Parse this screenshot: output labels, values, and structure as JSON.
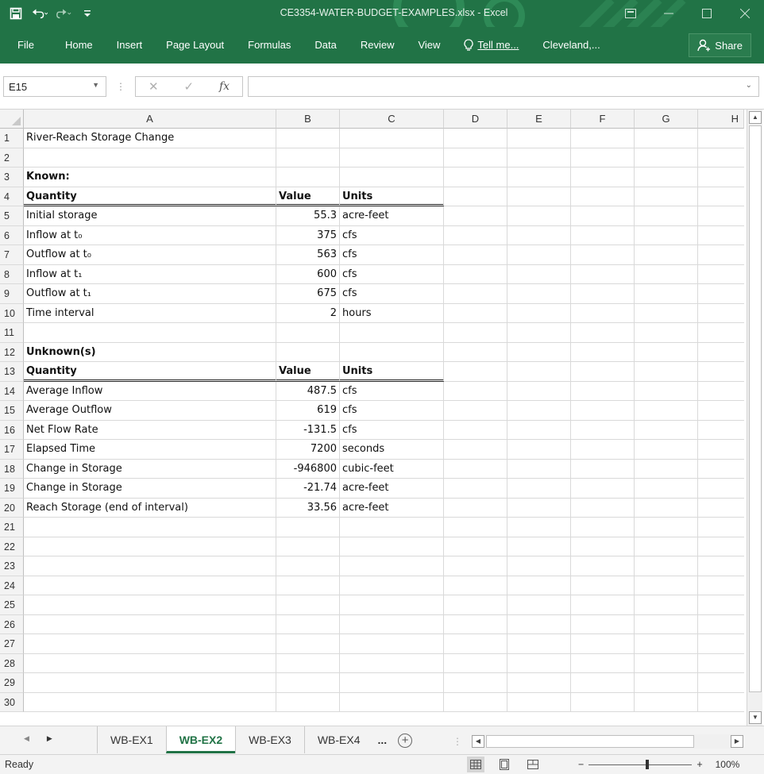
{
  "window": {
    "title": "CE3354-WATER-BUDGET-EXAMPLES.xlsx - Excel"
  },
  "ribbon": {
    "tabs": [
      "File",
      "Home",
      "Insert",
      "Page Layout",
      "Formulas",
      "Data",
      "Review",
      "View"
    ],
    "tell_me": "Tell me...",
    "user": "Cleveland,...",
    "share": "Share"
  },
  "formula_bar": {
    "name_box": "E15",
    "formula": "",
    "fx_label": "fx"
  },
  "columns": [
    "A",
    "B",
    "C",
    "D",
    "E",
    "F",
    "G",
    "H"
  ],
  "rows": [
    {
      "n": "1",
      "a": "River-Reach Storage Change",
      "b": "",
      "c": ""
    },
    {
      "n": "2",
      "a": "",
      "b": "",
      "c": ""
    },
    {
      "n": "3",
      "a": "Known:",
      "b": "",
      "c": ""
    },
    {
      "n": "4",
      "a": "Quantity",
      "b": "Value",
      "c": "Units"
    },
    {
      "n": "5",
      "a": "Initial storage",
      "b": "55.3",
      "c": "acre-feet"
    },
    {
      "n": "6",
      "a": "Inflow at t₀",
      "b": "375",
      "c": "cfs"
    },
    {
      "n": "7",
      "a": "Outflow at t₀",
      "b": "563",
      "c": "cfs"
    },
    {
      "n": "8",
      "a": "Inflow at t₁",
      "b": "600",
      "c": "cfs"
    },
    {
      "n": "9",
      "a": "Outflow at t₁",
      "b": "675",
      "c": "cfs"
    },
    {
      "n": "10",
      "a": "Time interval",
      "b": "2",
      "c": "hours"
    },
    {
      "n": "11",
      "a": "",
      "b": "",
      "c": ""
    },
    {
      "n": "12",
      "a": "Unknown(s)",
      "b": "",
      "c": ""
    },
    {
      "n": "13",
      "a": "Quantity",
      "b": "Value",
      "c": "Units"
    },
    {
      "n": "14",
      "a": "Average Inflow",
      "b": "487.5",
      "c": "cfs"
    },
    {
      "n": "15",
      "a": "Average Outflow",
      "b": "619",
      "c": "cfs"
    },
    {
      "n": "16",
      "a": "Net Flow Rate",
      "b": "-131.5",
      "c": "cfs"
    },
    {
      "n": "17",
      "a": "Elapsed Time",
      "b": "7200",
      "c": "seconds"
    },
    {
      "n": "18",
      "a": "Change in Storage",
      "b": "-946800",
      "c": "cubic-feet"
    },
    {
      "n": "19",
      "a": "Change in Storage",
      "b": "-21.74",
      "c": "acre-feet"
    },
    {
      "n": "20",
      "a": "Reach Storage (end of interval)",
      "b": "33.56",
      "c": "acre-feet"
    },
    {
      "n": "21",
      "a": "",
      "b": "",
      "c": ""
    },
    {
      "n": "22",
      "a": "",
      "b": "",
      "c": ""
    },
    {
      "n": "23",
      "a": "",
      "b": "",
      "c": ""
    },
    {
      "n": "24",
      "a": "",
      "b": "",
      "c": ""
    },
    {
      "n": "25",
      "a": "",
      "b": "",
      "c": ""
    },
    {
      "n": "26",
      "a": "",
      "b": "",
      "c": ""
    },
    {
      "n": "27",
      "a": "",
      "b": "",
      "c": ""
    },
    {
      "n": "28",
      "a": "",
      "b": "",
      "c": ""
    },
    {
      "n": "29",
      "a": "",
      "b": "",
      "c": ""
    },
    {
      "n": "30",
      "a": "",
      "b": "",
      "c": ""
    }
  ],
  "sheets": {
    "tabs": [
      "WB-EX1",
      "WB-EX2",
      "WB-EX3",
      "WB-EX4"
    ],
    "active": "WB-EX2",
    "more": "..."
  },
  "status": {
    "text": "Ready",
    "zoom": "100%"
  },
  "colors": {
    "excel_green": "#217346"
  }
}
